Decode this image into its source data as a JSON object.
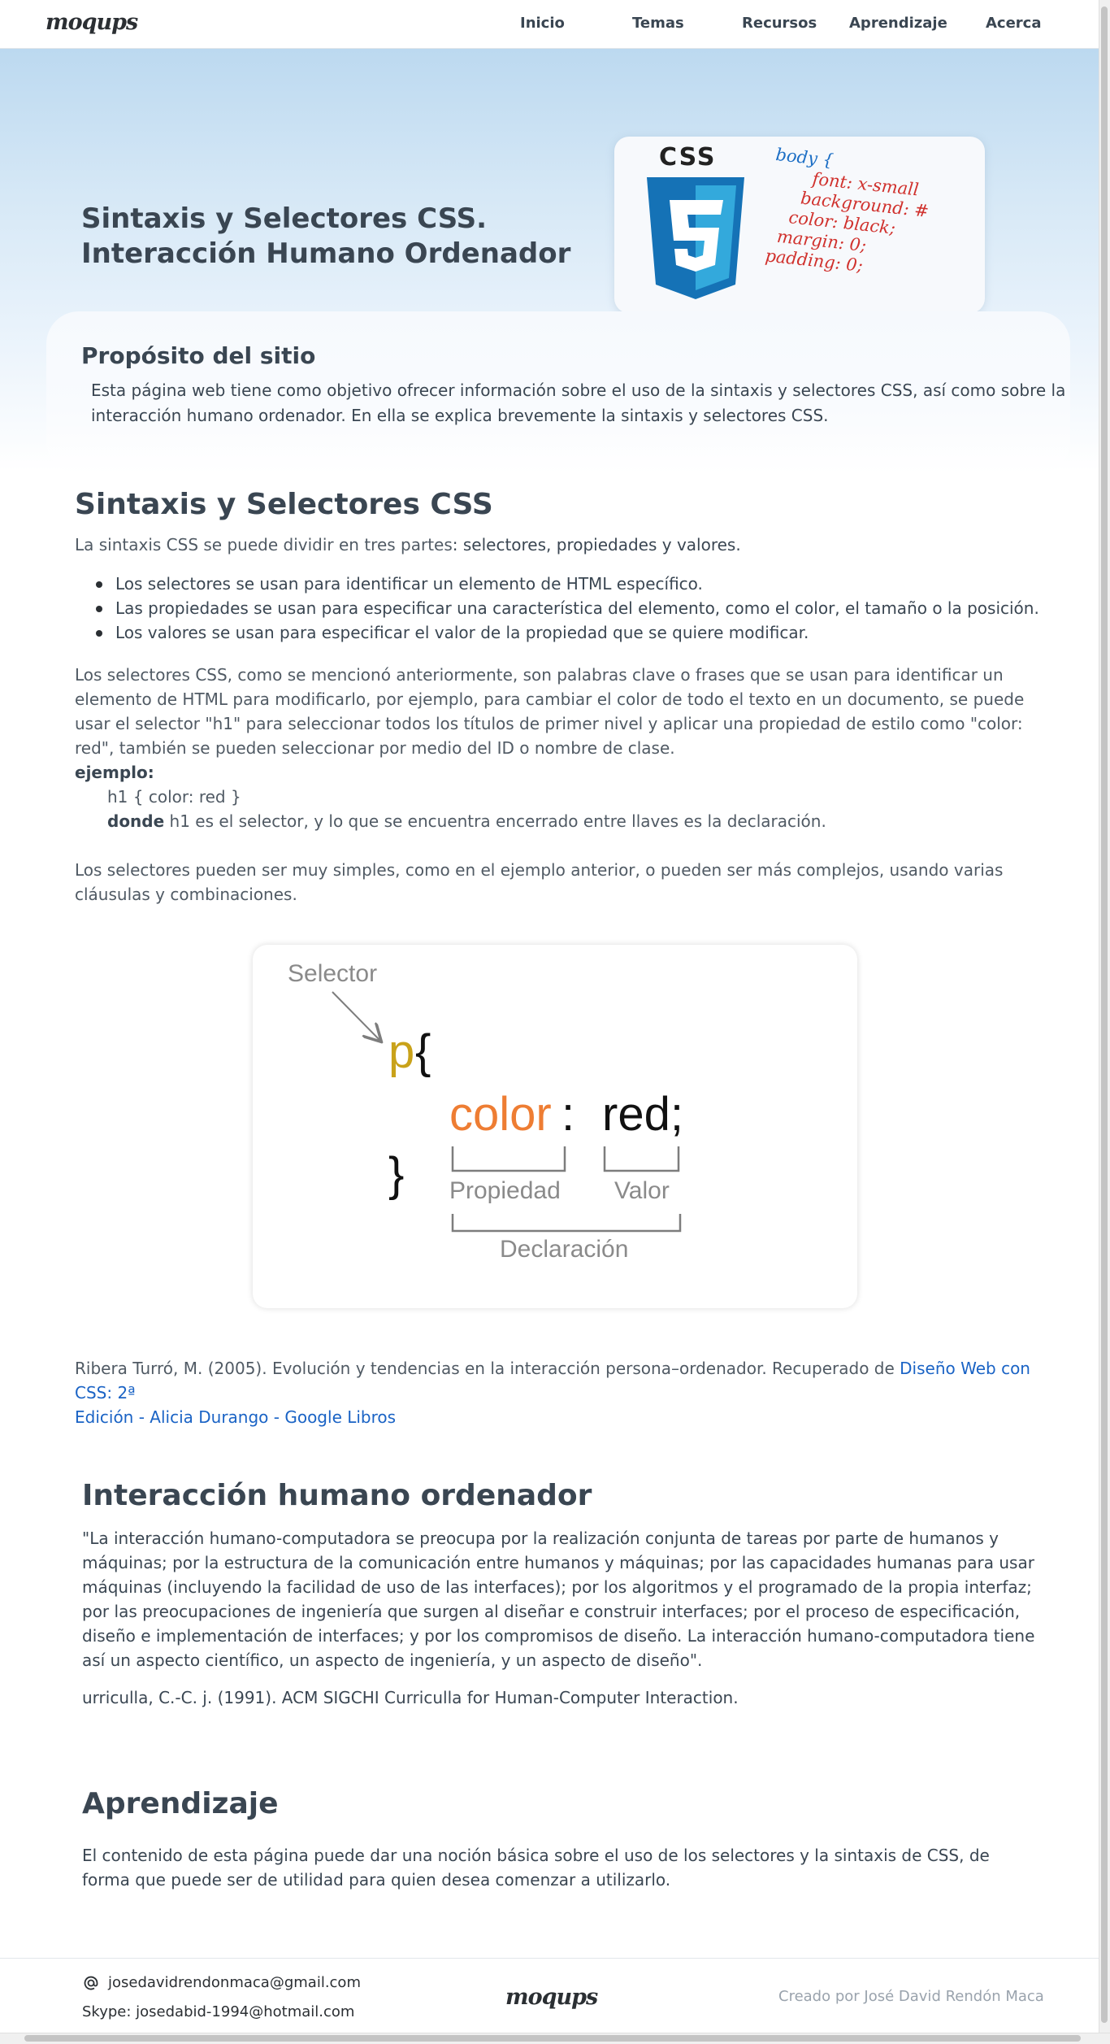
{
  "nav": {
    "logo": "moqups",
    "items": [
      "Inicio",
      "Temas",
      "Recursos",
      "Aprendizaje",
      "Acerca"
    ]
  },
  "hero": {
    "title_line1": "Sintaxis y Selectores CSS.",
    "title_line2": "Interacción Humano Ordenador",
    "image": {
      "badge": "CSS",
      "code": [
        "body {",
        "font: x-small",
        "background: #",
        "color: black;",
        "margin: 0;",
        "padding: 0;"
      ]
    }
  },
  "purpose": {
    "heading": "Propósito del sitio",
    "text": "Esta página web tiene como objetivo ofrecer información sobre el uso de la sintaxis y selectores CSS, así como sobre la interacción humano ordenador. En ella se explica brevemente la sintaxis y selectores CSS."
  },
  "syntax": {
    "heading": "Sintaxis y Selectores CSS",
    "intro_a": "La sintaxis CSS se puede dividir en tres partes",
    "intro_b": ": selectores, propiedades y valores.",
    "bullets": [
      "Los selectores se usan para identificar un elemento de HTML específico.",
      "Las propiedades se usan para especificar una característica del elemento, como el color, el tamaño o la posición.",
      "Los valores se usan para especificar el valor de la propiedad que se quiere modificar."
    ],
    "paragraph": "Los selectores CSS, como se mencionó anteriormente, son palabras clave o frases que se usan para identificar un elemento de HTML para modificarlo, por ejemplo, para cambiar el color de todo el texto en un documento, se puede usar el selector \"h1\" para seleccionar todos los títulos de primer nivel y aplicar una propiedad de estilo como \"color: red\", también se pueden seleccionar por medio del ID  o nombre de clase.",
    "example_label": "ejemplo:",
    "example_code": "h1 { color: red }",
    "donde_label": "donde",
    "donde_text": " h1 es el selector, y lo que se encuentra encerrado entre llaves es la declaración.",
    "paragraph2": "Los selectores pueden ser muy simples, como en el ejemplo anterior, o pueden ser más complejos, usando varias cláusulas y combinaciones.",
    "diagram": {
      "selector_label": "Selector",
      "selector": "p",
      "open_brace": "{",
      "close_brace": "}",
      "property": "color",
      "colon": ":",
      "value": "red;",
      "property_label": "Propiedad",
      "value_label": "Valor",
      "declaration_label": "Declaración",
      "colors": {
        "selector": "#c9a21a",
        "property": "#ee7d33",
        "text": "#111111",
        "label": "#8a8a8a"
      }
    },
    "citation": "Ribera Turró, M. (2005). Evolución y tendencias en la interacción persona–ordenador. Recuperado de ",
    "citation_link_line1": "Diseño Web con CSS: 2ª",
    "citation_link_line2": "Edición - Alicia Durango - Google Libros"
  },
  "hci": {
    "heading": "Interacción humano ordenador",
    "quote": "\"La interacción humano-computadora se preocupa por la realización conjunta de tareas por parte de humanos y máquinas; por la estructura de la comunicación entre humanos y máquinas; por las capacidades humanas para usar máquinas (incluyendo la facilidad de uso de las interfaces); por los algoritmos y el programado de la propia interfaz; por las preocupaciones de ingeniería que surgen al diseñar e construir interfaces; por el proceso de especificación, diseño e implementación de interfaces; y por los compromisos de diseño. La interacción humano-computadora tiene así un aspecto científico, un aspecto de ingeniería, y un aspecto de diseño\".",
    "citation": "urriculla, C.-C. j. (1991). ACM SIGCHI Curriculla for Human-Computer Interaction."
  },
  "learning": {
    "heading": "Aprendizaje",
    "text": "El contenido de esta página puede dar una noción básica sobre el uso de los selectores y la sintaxis de CSS, de forma que puede ser de utilidad para quien desea comenzar a utilizarlo."
  },
  "footer": {
    "email": "josedavidrendonmaca@gmail.com",
    "skype": "Skype: josedabid-1994@hotmail.com",
    "logo": "moqups",
    "credit": "Creado por José David Rendón Maca"
  }
}
